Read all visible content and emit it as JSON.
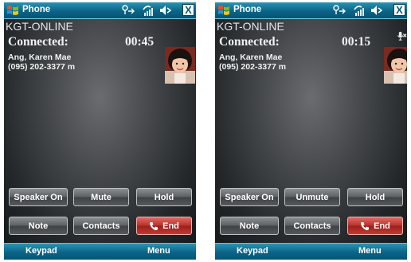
{
  "screens": [
    {
      "title": "Phone",
      "network": "KGT-ONLINE",
      "status": "Connected:",
      "timer": "00:45",
      "contact_name": "Ang, Karen Mae",
      "contact_number": "(095) 202-3377 m",
      "buttons": {
        "speaker": "Speaker On",
        "mute": "Mute",
        "hold": "Hold",
        "note": "Note",
        "contacts": "Contacts",
        "end": "End"
      },
      "softkeys": {
        "left": "Keypad",
        "right": "Menu"
      },
      "close": "X"
    },
    {
      "title": "Phone",
      "network": "KGT-ONLINE",
      "status": "Connected:",
      "timer": "00:15",
      "contact_name": "Ang, Karen Mae",
      "contact_number": "(095) 202-3377 m",
      "muted": true,
      "buttons": {
        "speaker": "Speaker On",
        "mute": "Unmute",
        "hold": "Hold",
        "note": "Note",
        "contacts": "Contacts",
        "end": "End"
      },
      "softkeys": {
        "left": "Keypad",
        "right": "Menu"
      },
      "close": "X"
    }
  ],
  "colors": {
    "title_bar": "#0b6487",
    "end_button": "#b8302a",
    "button_gray": "#5b5f62"
  },
  "icons": {
    "start": "windows-flag-icon",
    "connectivity": "connectivity-icon",
    "signal": "signal-strength-icon",
    "volume": "speaker-volume-icon",
    "end_call": "phone-handset-icon",
    "muted_mic": "microphone-muted-icon"
  }
}
